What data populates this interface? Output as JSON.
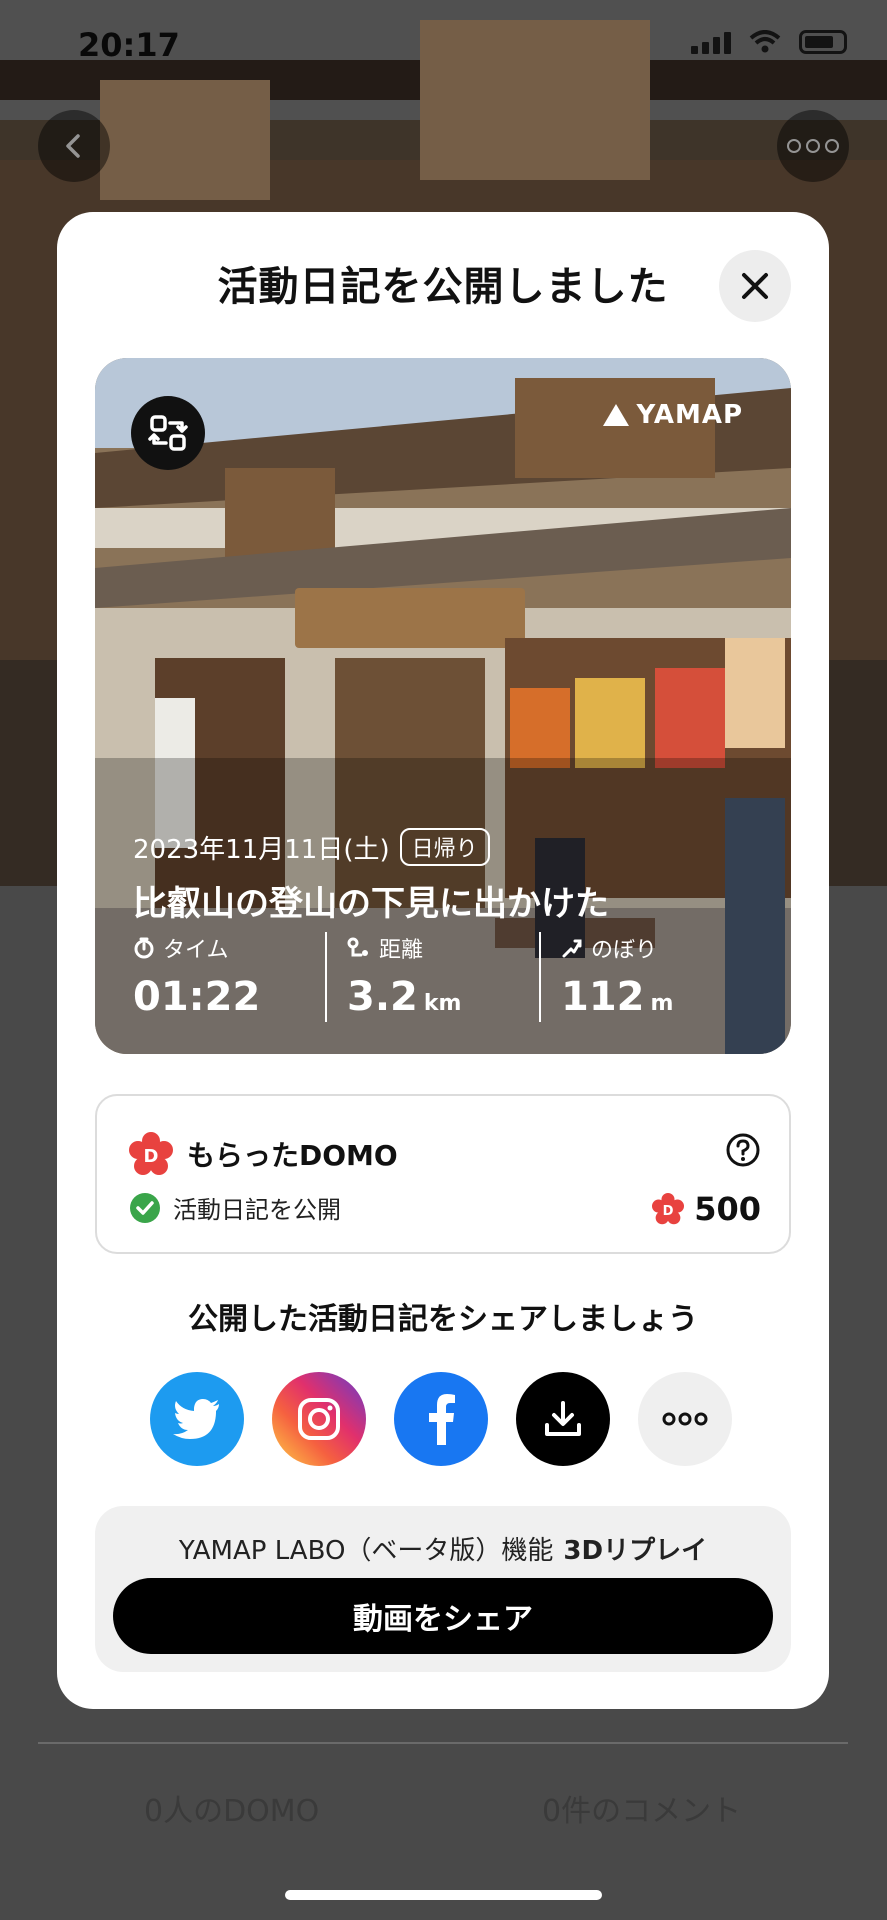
{
  "status_bar": {
    "time": "20:17"
  },
  "background": {
    "footer": {
      "domo_count": "0人のDOMO",
      "comment_count": "0件のコメント"
    }
  },
  "modal": {
    "title": "活動日記を公開しました",
    "card": {
      "logo_text": "YAMAP",
      "date": "2023年11月11日(土)",
      "badge": "日帰り",
      "activity_title": "比叡山の登山の下見に出かけた",
      "metrics": [
        {
          "label": "タイム",
          "value": "01:22",
          "unit": ""
        },
        {
          "label": "距離",
          "value": "3.2",
          "unit": "km"
        },
        {
          "label": "のぼり",
          "value": "112",
          "unit": "m"
        }
      ]
    },
    "domo": {
      "title": "もらったDOMO",
      "action": "活動日記を公開",
      "points": "500"
    },
    "share": {
      "heading": "公開した活動日記をシェアしましょう",
      "buttons": [
        "twitter-icon",
        "instagram-icon",
        "facebook-icon",
        "download-icon",
        "more-icon"
      ]
    },
    "labo": {
      "label": "YAMAP LABO（ベータ版）機能",
      "feature": "3Dリプレイ",
      "button": "動画をシェア"
    }
  },
  "colors": {
    "twitter": "#1d9bf0",
    "facebook": "#1877f2",
    "domo_red": "#e8423f",
    "check_green": "#3aa54a"
  }
}
